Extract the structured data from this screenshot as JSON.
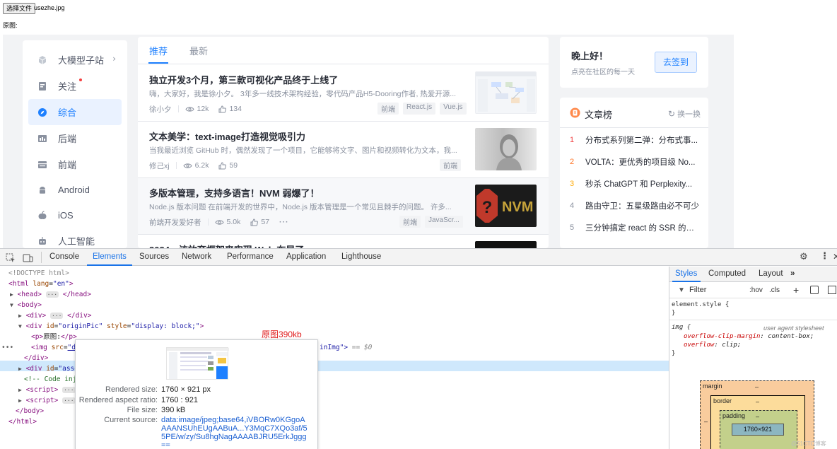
{
  "file_input": {
    "button_label": "选择文件",
    "file_name": "usezhe.jpg"
  },
  "original_label": "原图:",
  "sidebar": {
    "items": [
      {
        "label": "大模型子站",
        "icon": "cube-icon"
      },
      {
        "label": "关注",
        "icon": "follow-icon"
      },
      {
        "label": "综合",
        "icon": "compass-icon"
      },
      {
        "label": "后端",
        "icon": "backend-icon"
      },
      {
        "label": "前端",
        "icon": "frontend-icon"
      },
      {
        "label": "Android",
        "icon": "android-icon"
      },
      {
        "label": "iOS",
        "icon": "apple-icon"
      },
      {
        "label": "人工智能",
        "icon": "robot-icon"
      }
    ]
  },
  "feed": {
    "tabs": [
      "推荐",
      "最新"
    ],
    "articles": [
      {
        "title": "独立开发3个月，第三款可视化产品终于上线了",
        "desc": "嗨，大家好，我是徐小夕。 3年多一线技术架构经验，零代码产品H5-Dooring作者, 热爱开源...",
        "author": "徐小夕",
        "views": "12k",
        "likes": "134",
        "tags": [
          "前端",
          "React.js",
          "Vue.js"
        ]
      },
      {
        "title": "文本美学：text-image打造视觉吸引力",
        "desc": "当我最近浏览 GitHub 时，偶然发现了一个项目，它能够将文字、图片和视频转化为文本，我...",
        "author": "修己xj",
        "views": "6.2k",
        "likes": "59",
        "tags": [
          "前端"
        ]
      },
      {
        "title": "多版本管理，支持多语言！NVM 弱爆了！",
        "desc": "Node.js 版本问题 在前端开发的世界中，Node.js 版本管理是一个常见且棘手的问题。 许多...",
        "author": "前端开发爱好者",
        "views": "5.0k",
        "likes": "57",
        "more": "···",
        "tags": [
          "前端",
          "JavaScr..."
        ]
      },
      {
        "title": "2024，该放弃框架来实现 Web 布局了"
      }
    ]
  },
  "signin": {
    "greeting": "晚上好！",
    "sub": "点亮在社区的每一天",
    "button": "去签到"
  },
  "rank": {
    "title": "文章榜",
    "refresh": "换一换",
    "items": [
      {
        "num": "1",
        "text": "分布式系列第二弹：分布式事...",
        "color": "#f04142"
      },
      {
        "num": "2",
        "text": "VOLTA：更优秀的项目级 No...",
        "color": "#ff7426"
      },
      {
        "num": "3",
        "text": "秒杀 ChatGPT 和 Perplexity...",
        "color": "#ffac0c"
      },
      {
        "num": "4",
        "text": "路由守卫：五星级路由必不可少",
        "color": "#8a919f"
      },
      {
        "num": "5",
        "text": "三分钟搞定 react 的 SSR 的原...",
        "color": "#8a919f"
      }
    ]
  },
  "devtools": {
    "tabs": [
      "Console",
      "Elements",
      "Sources",
      "Network",
      "Performance",
      "Application",
      "Lighthouse"
    ],
    "red_note": "原图390kb",
    "dom": {
      "doctype": "<!DOCTYPE html>",
      "html_open_tag": "html",
      "lang_attr": "lang",
      "lang_val": "\"en\"",
      "head": "head",
      "head_close": "/head",
      "body": "body",
      "div": "div",
      "div_close": "/div",
      "origin_id": "\"originPic\"",
      "origin_style": "\"display: block;\"",
      "p_text": "原图:",
      "p_tag": "p",
      "p_close": "/p",
      "img_tag": "img",
      "img_src_attr": "src",
      "img_src_val": "\"da",
      "img_tail": "inImg\">",
      "sel_marker": "== $0",
      "asset_id": "\"asset",
      "comment": "<!-- Code inje",
      "script_tag": "script",
      "script_tail": "/s",
      "body_close": "/body",
      "html_close": "/html",
      "ellipsis": "···",
      "attr_id": "id",
      "attr_style": "style"
    },
    "tooltip": {
      "rendered_size_label": "Rendered size:",
      "rendered_size": "1760 × 921 px",
      "aspect_label": "Rendered aspect ratio:",
      "aspect": "1760 : 921",
      "file_size_label": "File size:",
      "file_size": "390 kB",
      "source_label": "Current source:",
      "source": "data:image/jpeg;base64,iVBORw0KGgoAAAANSUhEUgAABuA...Y3MqC7XQo3af/55PE/w/zy/Su8hgNagAAAABJRU5ErkJggg=="
    },
    "styles": {
      "tabs": [
        "Styles",
        "Computed",
        "Layout"
      ],
      "more": "»",
      "filter": "Filter",
      "hov": ":hov",
      "cls": ".cls",
      "element_style": "element.style {",
      "brace_close": "}",
      "img_rule": "img {",
      "ua": "user agent stylesheet",
      "prop1": "overflow-clip-margin",
      "val1": "content-box;",
      "prop2": "overflow",
      "val2": "clip;",
      "box": {
        "margin": "margin",
        "border": "border",
        "padding": "padding",
        "content": "1760×921",
        "dash": "–"
      }
    },
    "watermark": "@51CTO博客"
  }
}
